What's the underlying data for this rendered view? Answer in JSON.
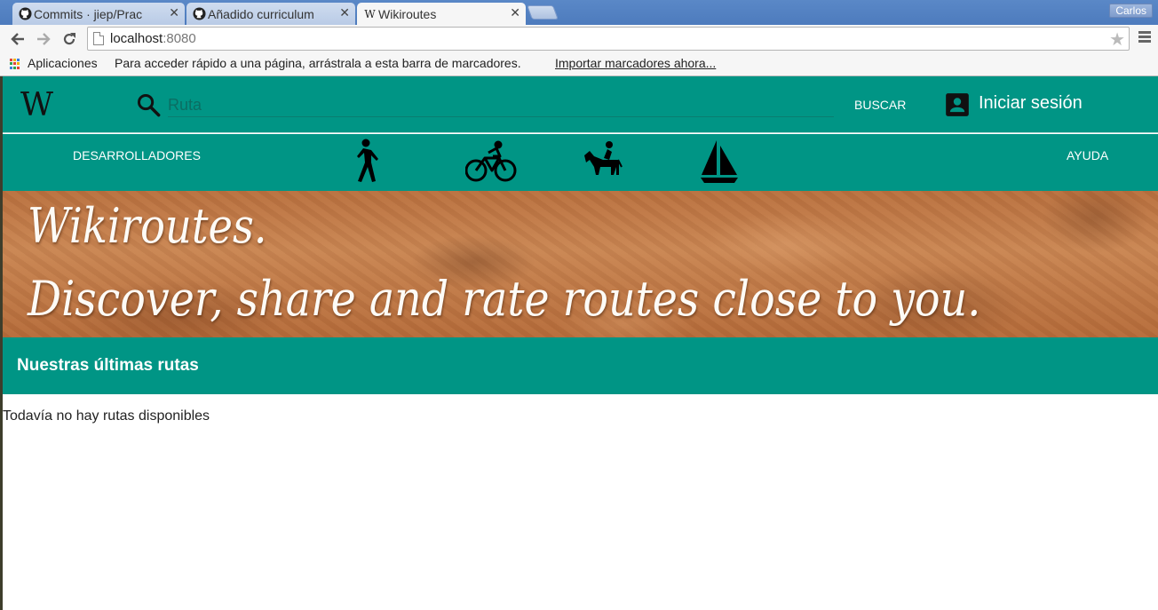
{
  "browser": {
    "tabs": [
      {
        "title": "Commits · jiep/Pract",
        "favicon": "github-icon",
        "state": "inactive"
      },
      {
        "title": "Añadido curriculum",
        "favicon": "github-icon",
        "state": "inactive"
      },
      {
        "title": "Wikiroutes",
        "favicon": "wikipedia-icon",
        "state": "active"
      }
    ],
    "user_name": "Carlos",
    "url_host": "localhost",
    "url_port": ":8080",
    "bookmarks_bar": {
      "apps_label": "Aplicaciones",
      "hint": "Para acceder rápido a una página, arrástrala a esta barra de marcadores.",
      "import_link": "Importar marcadores ahora..."
    }
  },
  "header": {
    "logo": "W",
    "search_placeholder": "Ruta",
    "search_button": "BUSCAR",
    "login_label": "Iniciar sesión"
  },
  "nav": {
    "developers": "DESARROLLADORES",
    "help": "AYUDA",
    "activities": [
      "walking-icon",
      "cycling-icon",
      "horse-riding-icon",
      "sailing-icon"
    ]
  },
  "banner": {
    "line1": "Wikiroutes.",
    "line2": "Discover, share and rate routes close to you."
  },
  "latest_routes": {
    "title": "Nuestras últimas rutas",
    "empty_message": "Todavía no hay rutas disponibles"
  },
  "colors": {
    "primary": "#009585",
    "banner_sand": "#c98653"
  }
}
